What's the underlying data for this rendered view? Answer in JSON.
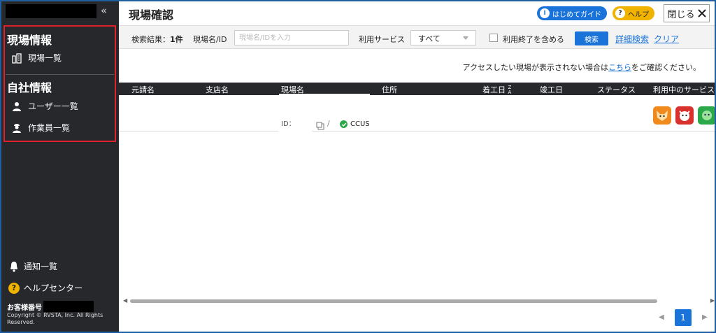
{
  "sidebar": {
    "collapse_icon": "«",
    "section_site": "現場情報",
    "site_list": "現場一覧",
    "section_company": "自社情報",
    "user_list": "ユーザー一覧",
    "worker_list": "作業員一覧",
    "notifications": "通知一覧",
    "help_center": "ヘルプセンター",
    "customer_no_label": "お客様番号",
    "copyright": "Copyright © RVSTA, Inc. All Rights Reserved."
  },
  "header": {
    "title": "現場確認",
    "guide_label": "はじめてガイド",
    "help_label": "ヘルプ",
    "close_label": "閉じる"
  },
  "search": {
    "result_label": "検索結果：",
    "result_count": "1件",
    "site_label": "現場名/ID",
    "site_placeholder": "現場名/IDを入力",
    "service_label": "利用サービス",
    "service_value": "すべて",
    "include_ended_label": "利用終了を含める",
    "search_button": "検索",
    "advanced_link": "詳細検索",
    "clear_link": "クリア"
  },
  "notice": {
    "prefix": "アクセスしたい現場が表示されない場合は",
    "link": "こちら",
    "suffix": "をご確認ください。"
  },
  "table": {
    "columns": [
      "元請名",
      "支店名",
      "現場名",
      "住所",
      "着工日",
      "竣工日",
      "ステータス",
      "利用中のサービス"
    ],
    "row": {
      "id_label": "ID：",
      "ccus": "CCUS"
    }
  },
  "pagination": {
    "prev": "◀",
    "page": "1",
    "next": "▶"
  },
  "colors": {
    "sidebar_bg": "#26282c",
    "accent": "#1a73d9",
    "highlight_border": "#e0202a",
    "help_yellow": "#f0b400"
  }
}
